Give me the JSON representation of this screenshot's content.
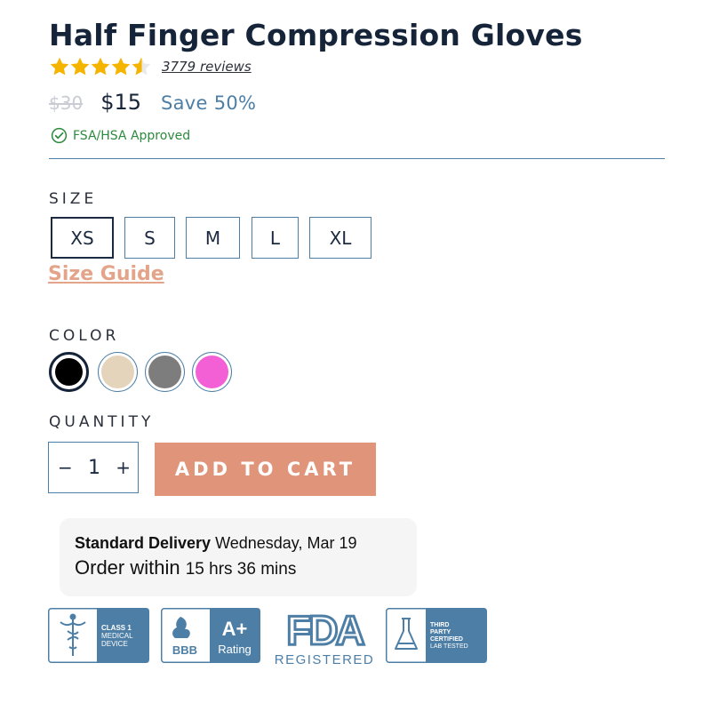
{
  "product": {
    "title": "Half Finger Compression Gloves",
    "rating": 4.5,
    "reviews_label": "3779 reviews",
    "old_price": "$30",
    "price": "$15",
    "save_label": "Save 50%",
    "fsa_label": "FSA/HSA Approved"
  },
  "size": {
    "label": "SIZE",
    "options": [
      "XS",
      "S",
      "M",
      "L",
      "XL"
    ],
    "selected": "XS",
    "guide_label": "Size Guide"
  },
  "color": {
    "label": "COLOR",
    "options": [
      {
        "name": "black",
        "hex": "#000000"
      },
      {
        "name": "beige",
        "hex": "#e4d4bc"
      },
      {
        "name": "gray",
        "hex": "#7d7d7d"
      },
      {
        "name": "pink",
        "hex": "#f35fd4"
      }
    ],
    "selected": "black"
  },
  "quantity": {
    "label": "QUANTITY",
    "minus": "−",
    "value": "1",
    "plus": "+"
  },
  "cart": {
    "button_label": "ADD TO CART"
  },
  "delivery": {
    "label": "Standard Delivery",
    "date": "Wednesday, Mar 19",
    "order_within": "Order within",
    "countdown": "15 hrs 36 mins"
  },
  "badges": {
    "class1_line1": "CLASS 1",
    "class1_line2": "MEDICAL",
    "class1_line3": "DEVICE",
    "bbb_label": "BBB",
    "bbb_grade": "A+",
    "bbb_rating": "Rating",
    "fda_label": "FDA",
    "fda_sub": "REGISTERED",
    "lab_line1": "THIRD",
    "lab_line2": "PARTY",
    "lab_line3": "CERTIFIED",
    "lab_line4": "LAB TESTED"
  },
  "colors": {
    "navy": "#16243a",
    "accent_blue": "#4d7fa6",
    "cta": "#e0957a",
    "star": "#f5b400",
    "fsa_green": "#2d8a3e"
  }
}
